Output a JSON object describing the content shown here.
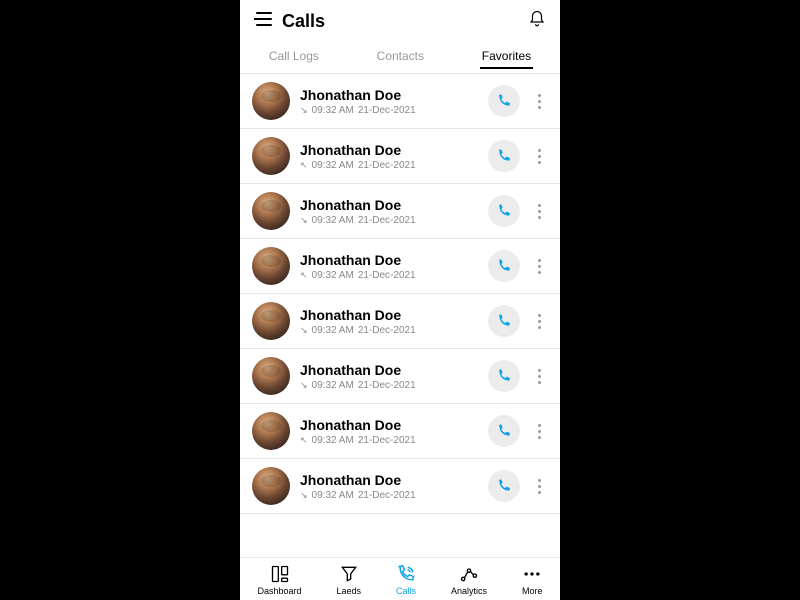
{
  "header": {
    "title": "Calls"
  },
  "tabs": [
    {
      "label": "Call Logs",
      "active": false
    },
    {
      "label": "Contacts",
      "active": false
    },
    {
      "label": "Favorites",
      "active": true
    }
  ],
  "calls": [
    {
      "name": "Jhonathan Doe",
      "direction": "in",
      "time": "09:32 AM",
      "date": "21-Dec-2021"
    },
    {
      "name": "Jhonathan Doe",
      "direction": "out",
      "time": "09:32 AM",
      "date": "21-Dec-2021"
    },
    {
      "name": "Jhonathan Doe",
      "direction": "in",
      "time": "09:32 AM",
      "date": "21-Dec-2021"
    },
    {
      "name": "Jhonathan Doe",
      "direction": "out",
      "time": "09:32 AM",
      "date": "21-Dec-2021"
    },
    {
      "name": "Jhonathan Doe",
      "direction": "in",
      "time": "09:32 AM",
      "date": "21-Dec-2021"
    },
    {
      "name": "Jhonathan Doe",
      "direction": "in",
      "time": "09:32 AM",
      "date": "21-Dec-2021"
    },
    {
      "name": "Jhonathan Doe",
      "direction": "out",
      "time": "09:32 AM",
      "date": "21-Dec-2021"
    },
    {
      "name": "Jhonathan Doe",
      "direction": "in",
      "time": "09:32 AM",
      "date": "21-Dec-2021"
    }
  ],
  "bottomnav": [
    {
      "label": "Dashboard",
      "active": false
    },
    {
      "label": "Laeds",
      "active": false
    },
    {
      "label": "Calls",
      "active": true
    },
    {
      "label": "Analytics",
      "active": false
    },
    {
      "label": "More",
      "active": false
    }
  ],
  "direction_glyph": {
    "in": "↘",
    "out": "↖"
  }
}
